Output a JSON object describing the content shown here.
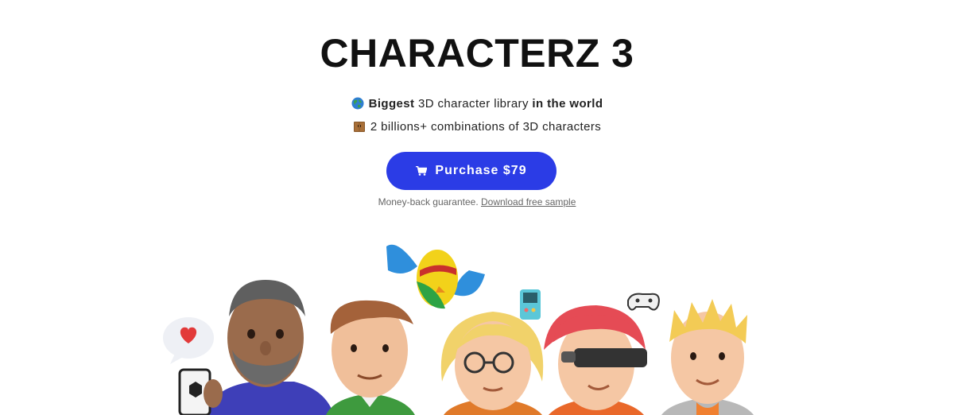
{
  "hero": {
    "title": "CHARACTERZ 3"
  },
  "features": [
    {
      "icon": "globe-icon",
      "bold_start": "Biggest",
      "middle": " 3D character library ",
      "bold_end": "in the world"
    },
    {
      "icon": "wardrobe-icon",
      "text": "2 billions+ combinations of 3D characters"
    }
  ],
  "cta": {
    "icon": "cart-icon",
    "label": "Purchase $79",
    "color": "#2b3ce6"
  },
  "guarantee": {
    "text": "Money-back guarantee. ",
    "link_label": "Download free sample"
  },
  "characters": [
    "heart-speech-bubble-icon",
    "bearded-man-with-phone",
    "man-brown-hair-green-vest",
    "flying-bird-superhero",
    "woman-blonde-glasses",
    "handheld-game-icon",
    "woman-red-hair-vr-headset",
    "gamepad-icon",
    "man-spiky-blonde-hair"
  ]
}
